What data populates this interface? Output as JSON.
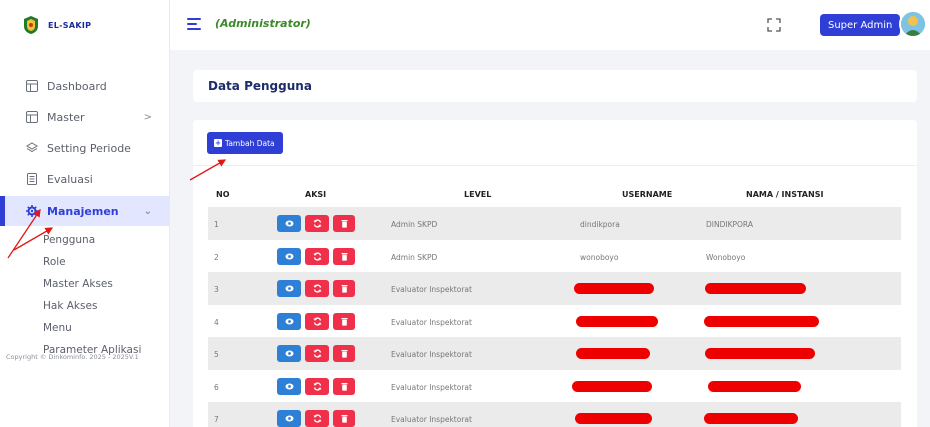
{
  "brand": {
    "name": "EL-SAKIP"
  },
  "sidebar": {
    "items": [
      {
        "label": "Dashboard",
        "icon": "dashboard-icon"
      },
      {
        "label": "Master",
        "icon": "master-icon",
        "chevron": ">"
      },
      {
        "label": "Setting Periode",
        "icon": "layers-icon"
      },
      {
        "label": "Evaluasi",
        "icon": "document-icon"
      },
      {
        "label": "Manajemen",
        "icon": "gear-icon",
        "chevron": "⌄"
      }
    ],
    "submenu": [
      {
        "label": "Pengguna"
      },
      {
        "label": "Role"
      },
      {
        "label": "Master Akses"
      },
      {
        "label": "Hak Akses"
      },
      {
        "label": "Menu"
      },
      {
        "label": "Parameter Aplikasi"
      }
    ],
    "copyright": "Copyright © Dinkominfo. 2025 - 2025V.1"
  },
  "topbar": {
    "role": "(Administrator)",
    "user": "Super Admin"
  },
  "page": {
    "title": "Data Pengguna",
    "add_button": "Tambah Data"
  },
  "table": {
    "headers": [
      "NO",
      "AKSI",
      "LEVEL",
      "USERNAME",
      "NAMA / INSTANSI"
    ],
    "rows": [
      {
        "no": "1",
        "level": "Admin SKPD",
        "username": "dindikpora",
        "nama": "DINDIKPORA"
      },
      {
        "no": "2",
        "level": "Admin SKPD",
        "username": "wonoboyo",
        "nama": "Wonoboyo"
      },
      {
        "no": "3",
        "level": "Evaluator Inspektorat",
        "username": "",
        "nama": ""
      },
      {
        "no": "4",
        "level": "Evaluator Inspektorat",
        "username": "",
        "nama": ""
      },
      {
        "no": "5",
        "level": "Evaluator Inspektorat",
        "username": "",
        "nama": ""
      },
      {
        "no": "6",
        "level": "Evaluator Inspektorat",
        "username": "",
        "nama": ""
      },
      {
        "no": "7",
        "level": "Evaluator Inspektorat",
        "username": "",
        "nama": ""
      }
    ]
  },
  "colors": {
    "primary": "#2f3fd6",
    "danger": "#f0304a",
    "info": "#2e7fd6",
    "role_green": "#3a8a2a",
    "annotation_red": "#ee0000"
  }
}
